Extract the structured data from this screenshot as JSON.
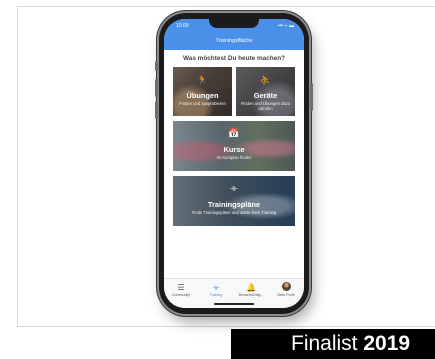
{
  "status_bar": {
    "time": "10:00",
    "signal": "••• ⌁ ▬"
  },
  "nav": {
    "title": "Trainingsfläche"
  },
  "prompt": "Was möchtest Du heute machen?",
  "cards": {
    "uebungen": {
      "title": "Übungen",
      "subtitle": "Finden und ausprobieren",
      "icon": "exercise-person-icon"
    },
    "geraete": {
      "title": "Geräte",
      "subtitle": "Finden und Übungen dazu abrufen",
      "icon": "treadmill-icon"
    },
    "kurse": {
      "title": "Kurse",
      "subtitle": "Im Kursplan finden",
      "icon": "calendar-icon"
    },
    "plaene": {
      "title": "Trainingspläne",
      "subtitle": "Finde Trainingspläne und starte Dein Training",
      "icon": "dumbbell-icon"
    }
  },
  "tabs": [
    {
      "label": "Community",
      "icon": "list-icon",
      "active": false
    },
    {
      "label": "Training",
      "icon": "dumbbell-icon",
      "active": true
    },
    {
      "label": "Benachrichtig...",
      "icon": "bell-icon",
      "active": false
    },
    {
      "label": "Mein Profil",
      "icon": "avatar",
      "active": false
    }
  ],
  "banner": {
    "text": "Finalist",
    "year": "2019"
  },
  "colors": {
    "accent": "#4a90e8",
    "banner_bg": "#000000"
  }
}
